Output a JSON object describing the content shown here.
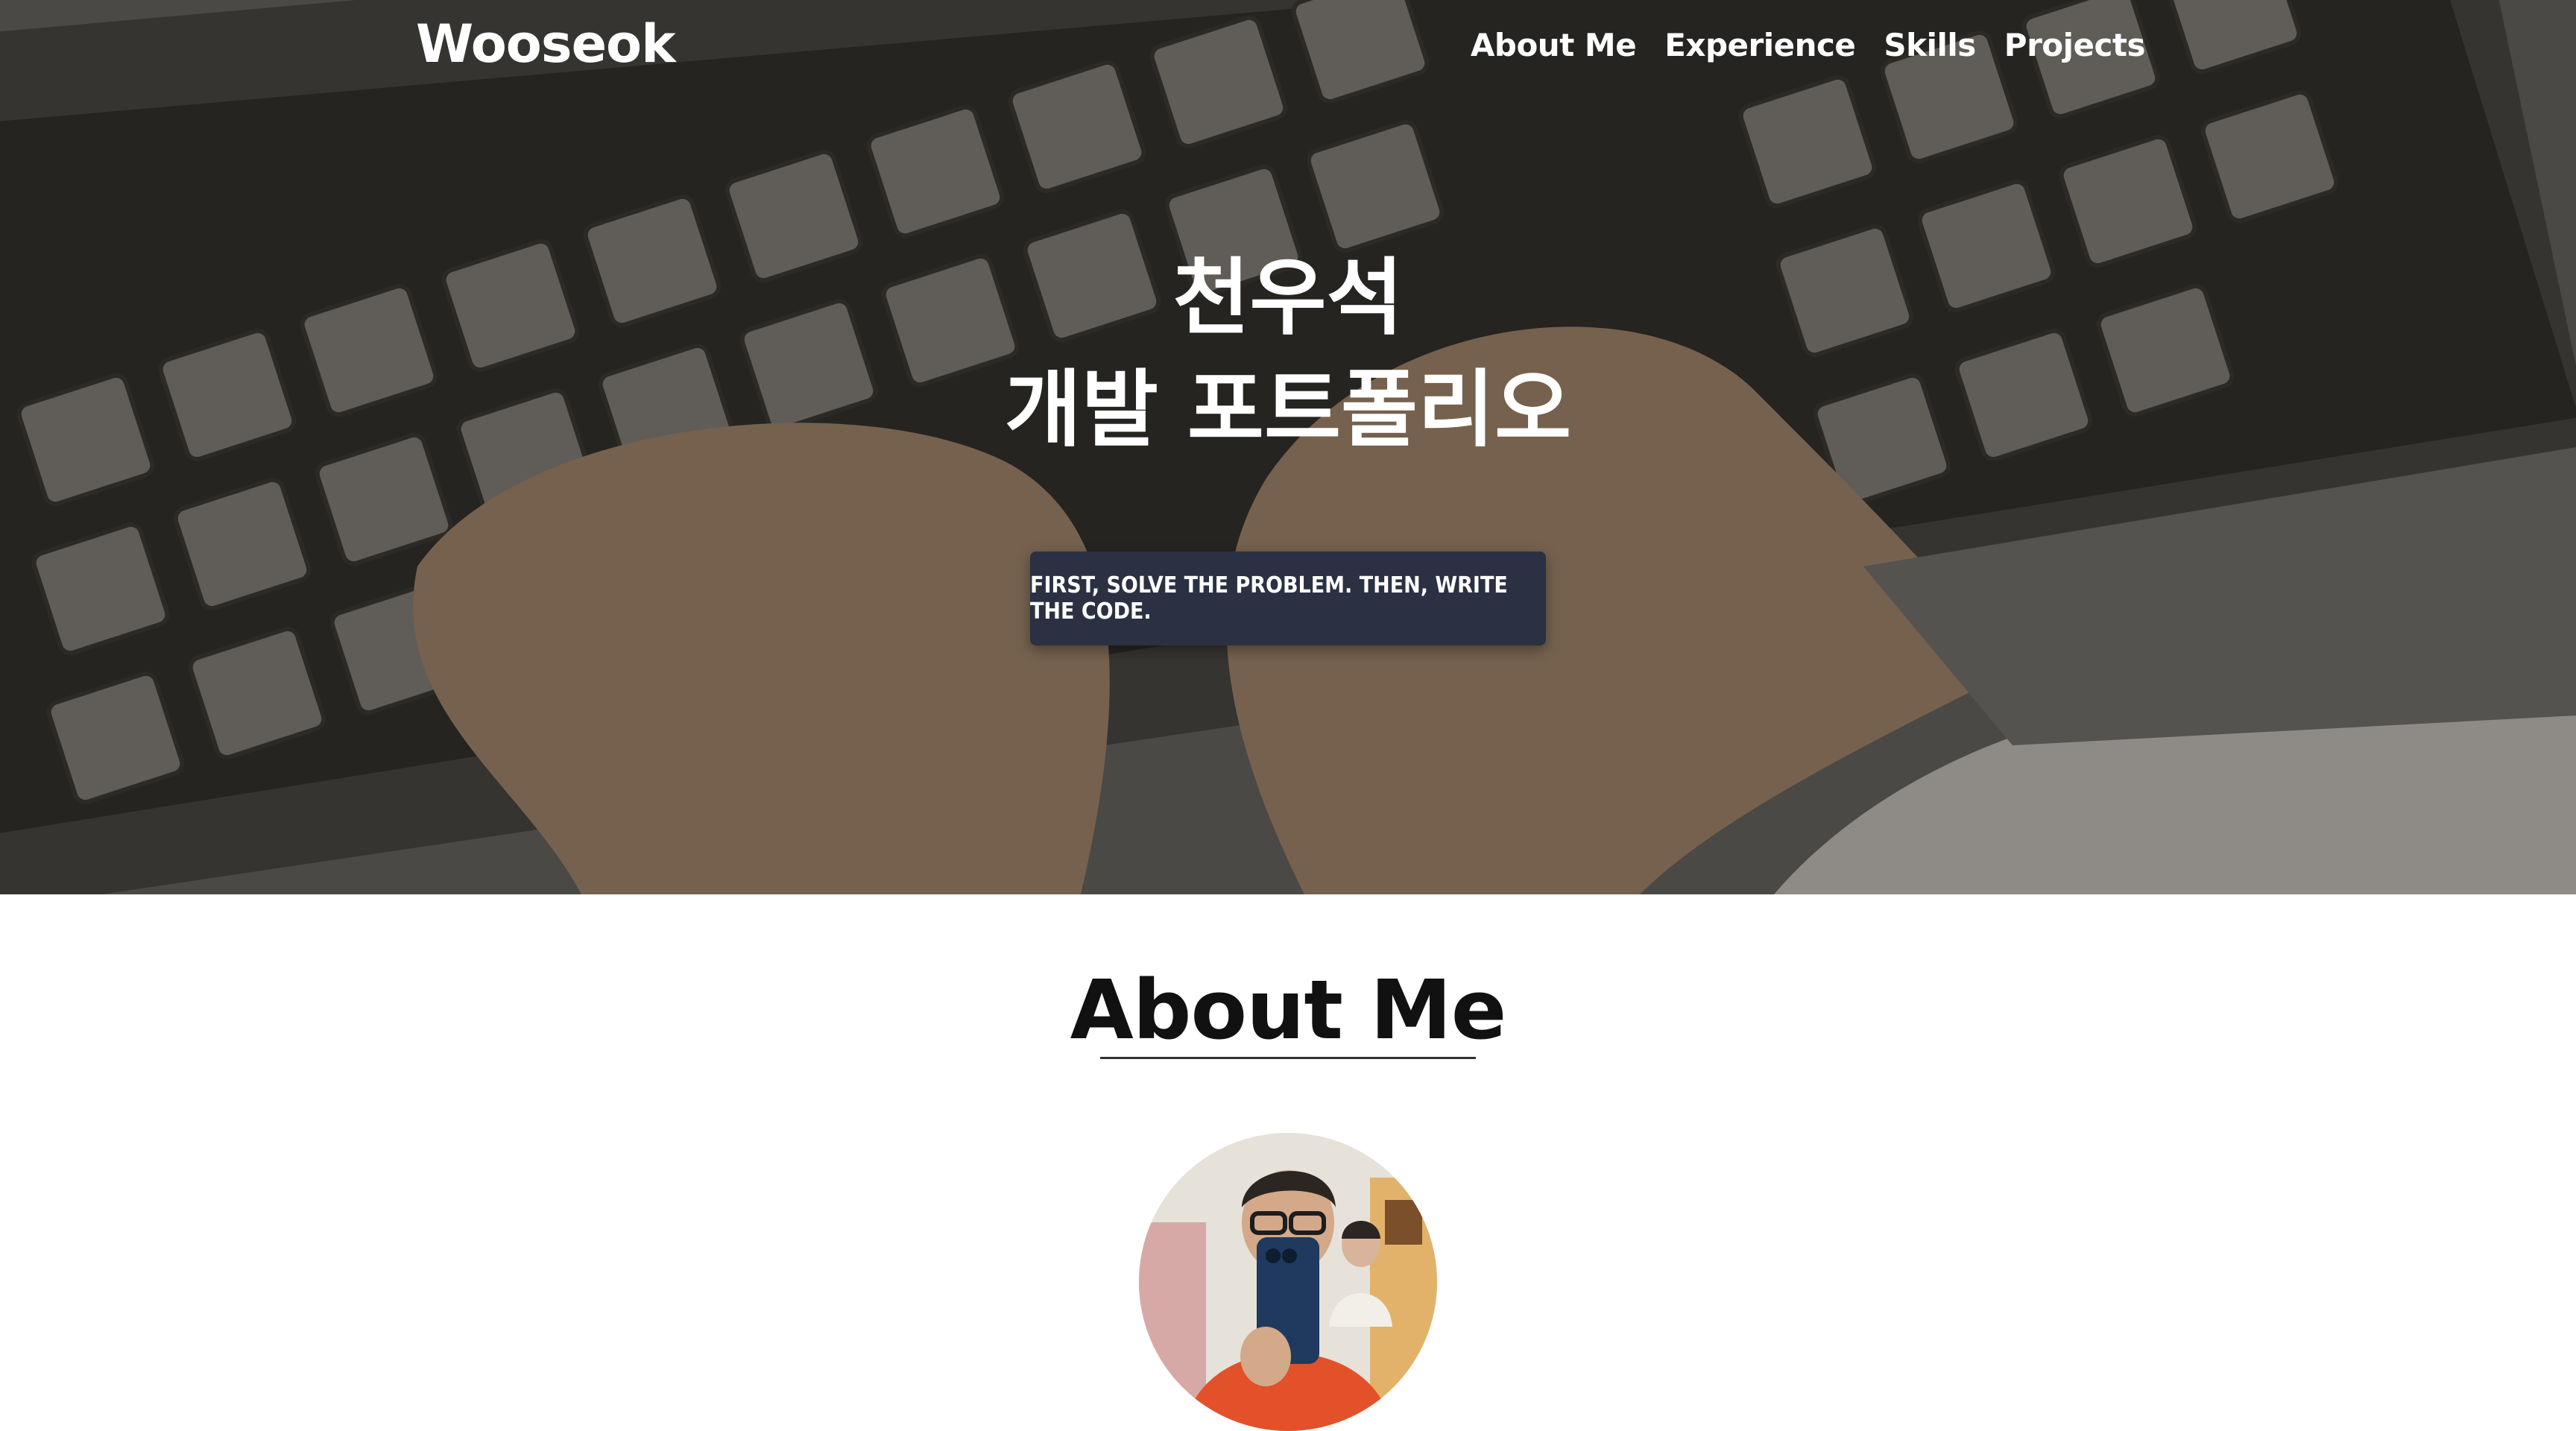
{
  "nav": {
    "brand": "Wooseok",
    "links": [
      {
        "label": "About Me"
      },
      {
        "label": "Experience"
      },
      {
        "label": "Skills"
      },
      {
        "label": "Projects"
      }
    ]
  },
  "hero": {
    "title_line1": "천우석",
    "title_line2": "개발 포트폴리오",
    "motto": "First, solve the problem. Then, write the code.",
    "background_image": "keyboard-typing-illustration"
  },
  "about": {
    "title": "About Me",
    "avatar": "profile-photo"
  },
  "colors": {
    "hero_overlay": "#3b3a38",
    "motto_bg": "#2b3142",
    "text_light": "#ffffff",
    "text_dark": "#111111"
  }
}
